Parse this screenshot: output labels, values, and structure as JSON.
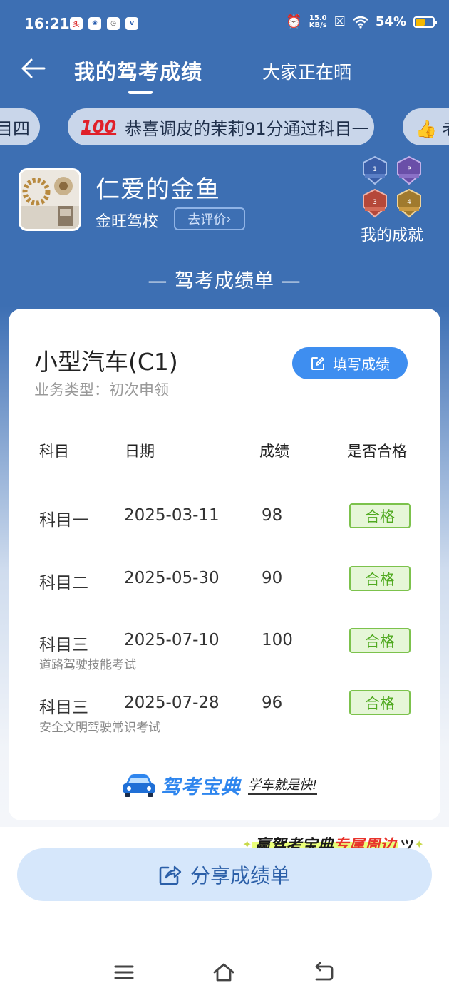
{
  "status_bar": {
    "time": "16:21",
    "left_icons": [
      "toutiao-icon",
      "baidu-icon",
      "alarm-icon",
      "vivo-icon"
    ],
    "net_speed_value": "15.0",
    "net_speed_unit": "KB/s",
    "battery": "54%",
    "battery_level": 0.54
  },
  "header": {
    "active_tab": "我的驾考成绩",
    "other_tab": "大家正在晒"
  },
  "ticker": {
    "left_partial": "目四",
    "main": "恭喜调皮的茉莉91分通过科目一",
    "main_emoji": "100",
    "right_partial": "👍 老"
  },
  "profile": {
    "name": "仁爱的金鱼",
    "school": "金旺驾校",
    "review_button": "去评价",
    "achievements_label": "我的成就",
    "badge_labels": [
      "科一",
      "科二",
      "科三",
      "科四"
    ]
  },
  "report_title": "— 驾考成绩单 —",
  "card": {
    "car_type": "小型汽车(C1)",
    "business_type": "业务类型：初次申领",
    "fill_button": "填写成绩",
    "columns": [
      "科目",
      "日期",
      "成绩",
      "是否合格"
    ],
    "rows": [
      {
        "subject": "科目一",
        "date": "2025-03-11",
        "score": "98",
        "status": "合格",
        "note": ""
      },
      {
        "subject": "科目二",
        "date": "2025-05-30",
        "score": "90",
        "status": "合格",
        "note": ""
      },
      {
        "subject": "科目三",
        "date": "2025-07-10",
        "score": "100",
        "status": "合格",
        "note": "道路驾驶技能考试"
      },
      {
        "subject": "科目三",
        "date": "2025-07-28",
        "score": "96",
        "status": "合格",
        "note": "安全文明驾驶常识考试"
      }
    ],
    "brand_name": "驾考宝典",
    "brand_slogan": "学车就是快!"
  },
  "promo": {
    "prefix": "赢驾考宝典",
    "highlight": "专属周边"
  },
  "share_button": "分享成绩单",
  "colors": {
    "header_blue": "#3d6fb3",
    "accent_blue": "#3e8ef0",
    "pass_green": "#4fa91f",
    "share_bg": "#d6e7fb"
  }
}
